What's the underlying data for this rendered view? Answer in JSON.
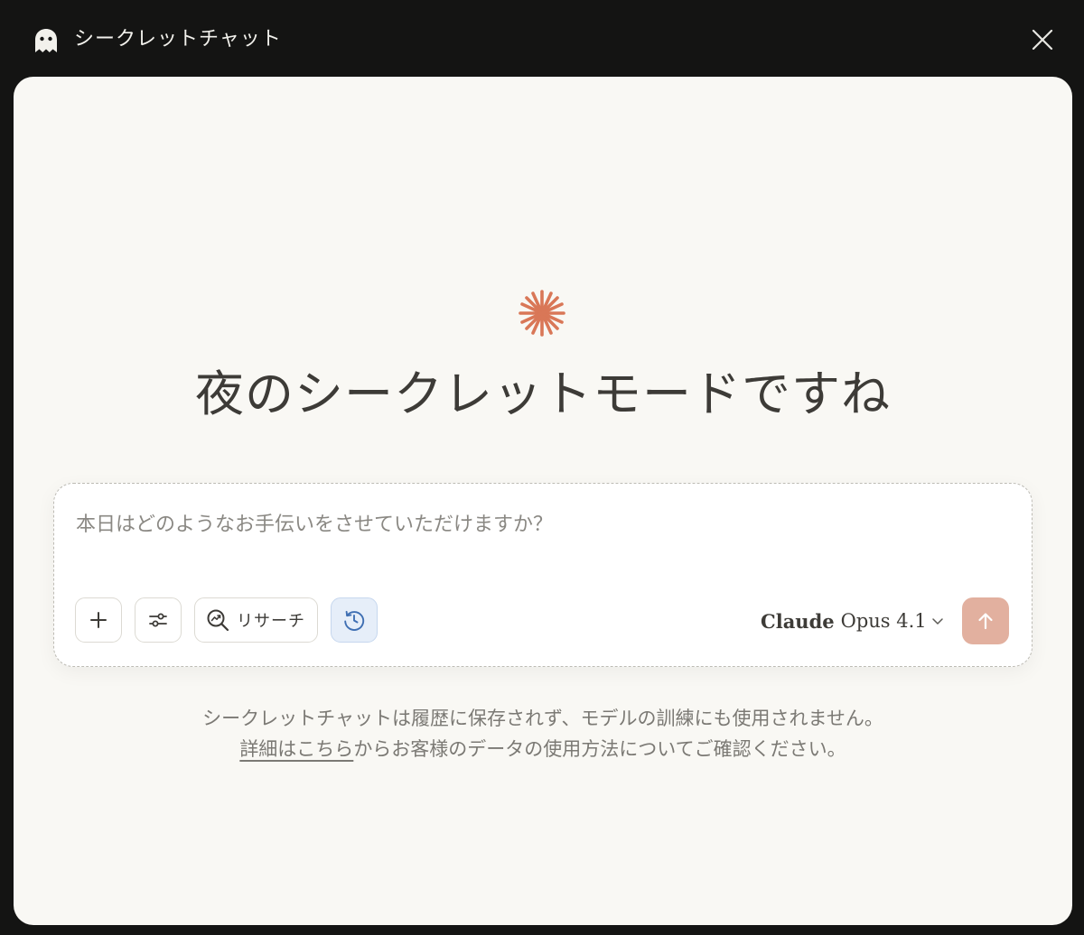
{
  "window": {
    "title": "シークレットチャット",
    "ghost_icon": "ghost-icon",
    "close_icon": "close-icon"
  },
  "main": {
    "spark_icon": "claude-spark-icon",
    "greeting": "夜のシークレットモードですね"
  },
  "composer": {
    "placeholder": "本日はどのようなお手伝いをさせていただけますか？",
    "value": "",
    "research_label": "リサーチ",
    "model_name_bold": "Claude",
    "model_name_rest": "Opus 4.1",
    "send_icon": "arrow-up-icon"
  },
  "disclaimer": {
    "line1": "シークレットチャットは履歴に保存されず、モデルの訓練にも使用されません。",
    "link_text": "詳細はこちら",
    "line2_rest": "からお客様のデータの使用方法についてご確認ください。"
  },
  "colors": {
    "titlebar_bg": "#141413",
    "panel_bg": "#f9f8f4",
    "accent_spark": "#d97757",
    "send_button_bg": "#e2b09f",
    "history_button_bg": "#e6eef9"
  }
}
